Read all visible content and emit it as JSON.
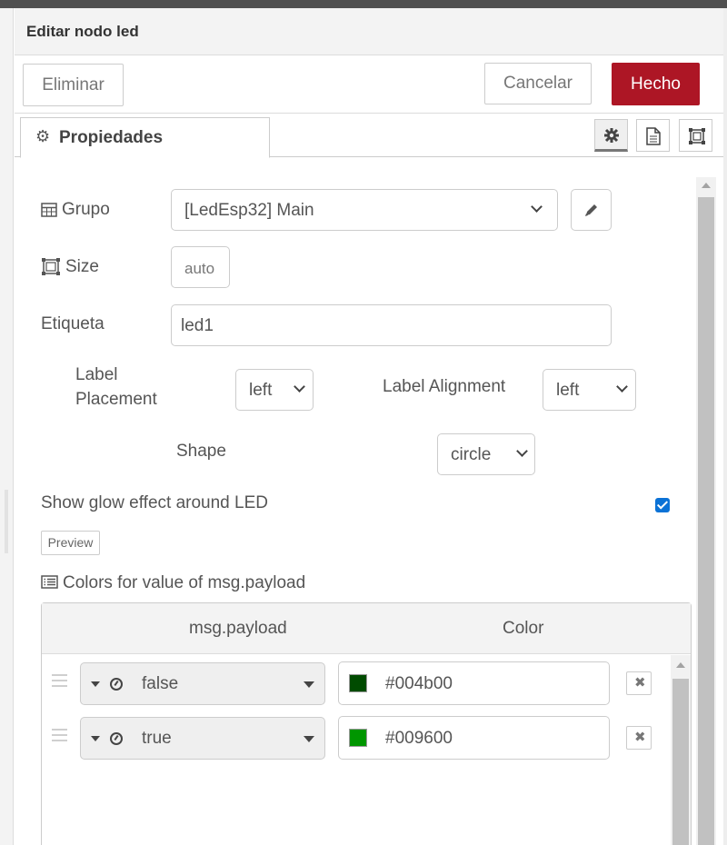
{
  "tray": {
    "title": "Editar nodo led",
    "delete_label": "Eliminar",
    "cancel_label": "Cancelar",
    "done_label": "Hecho"
  },
  "tabs": {
    "properties_label": "Propiedades"
  },
  "form": {
    "group_label": "Grupo",
    "group_value": "[LedEsp32] Main",
    "size_label": "Size",
    "size_value": "auto",
    "label_label": "Etiqueta",
    "label_value": "led1",
    "label_placement_line1": "Label",
    "label_placement_line2": "Placement",
    "label_placement_value": "left",
    "label_alignment_label": "Label Alignment",
    "label_alignment_value": "left",
    "shape_label": "Shape",
    "shape_value": "circle",
    "glow_label": "Show glow effect around LED",
    "glow_checked": true,
    "preview_label": "Preview",
    "colors_label": "Colors for value of msg.payload"
  },
  "table": {
    "col_payload": "msg.payload",
    "col_color": "Color",
    "rows": [
      {
        "value": "false",
        "color": "#004b00"
      },
      {
        "value": "true",
        "color": "#009600"
      }
    ]
  },
  "colors": {
    "done_button": "#ad1625",
    "checkbox": "#0b72d6"
  }
}
